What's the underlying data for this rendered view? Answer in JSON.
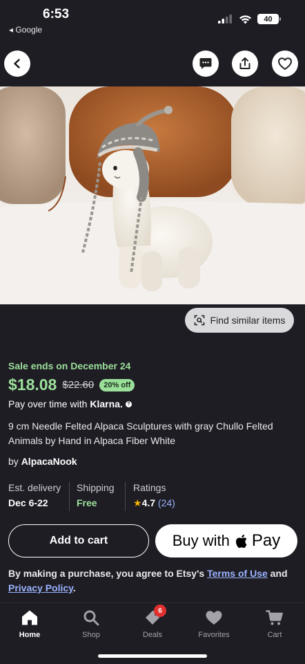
{
  "status_bar": {
    "time": "6:53",
    "back_app": "◂ Google",
    "battery": "40"
  },
  "product": {
    "find_similar": "Find similar items",
    "sale_ends": "Sale ends on December 24",
    "price": "$18.08",
    "original_price": "$22.60",
    "discount": "20% off",
    "pay_over_time": "Pay over time with",
    "klarna": "Klarna.",
    "title": "9 cm Needle Felted Alpaca Sculptures with gray Chullo Felted Animals by Hand in Alpaca Fiber White",
    "by_prefix": "by",
    "shop_name": "AlpacaNook"
  },
  "meta": {
    "delivery_label": "Est. delivery",
    "delivery_value": "Dec 6-22",
    "shipping_label": "Shipping",
    "shipping_value": "Free",
    "ratings_label": "Ratings",
    "rating": "4.7",
    "rating_count": "(24)"
  },
  "actions": {
    "add_to_cart": "Add to cart",
    "buy_with": "Buy with",
    "pay": "Pay"
  },
  "legal": {
    "text1": "By making a purchase, you agree to Etsy's",
    "terms": "Terms of Use",
    "and": "and",
    "privacy": "Privacy Policy",
    "period": "."
  },
  "tabs": [
    {
      "label": "Home",
      "icon": "home-icon"
    },
    {
      "label": "Shop",
      "icon": "search-icon"
    },
    {
      "label": "Deals",
      "icon": "tag-icon",
      "badge": "6"
    },
    {
      "label": "Favorites",
      "icon": "heart-icon"
    },
    {
      "label": "Cart",
      "icon": "cart-icon"
    }
  ],
  "colors": {
    "background": "#1f1d24",
    "sale_green": "#9be09a",
    "link_blue": "#9ab4ff",
    "badge_red": "#e0312f"
  }
}
